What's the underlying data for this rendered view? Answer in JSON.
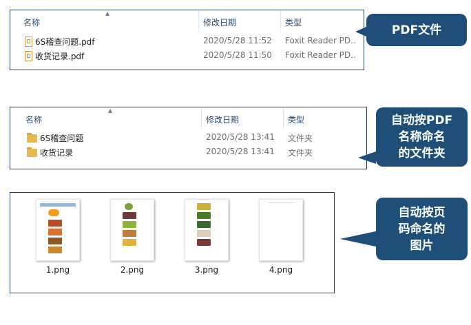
{
  "columns": {
    "name": "名称",
    "modified": "修改日期",
    "type": "类型"
  },
  "pdf_list": [
    {
      "name": "6S稽查问题.pdf",
      "date": "2020/5/28 11:52",
      "type": "Foxit Reader PD..."
    },
    {
      "name": "收货记录.pdf",
      "date": "2020/5/28 11:50",
      "type": "Foxit Reader PD..."
    }
  ],
  "folder_list": [
    {
      "name": "6S稽查问题",
      "date": "2020/5/28 13:41",
      "type": "文件夹"
    },
    {
      "name": "收货记录",
      "date": "2020/5/28 13:41",
      "type": "文件夹"
    }
  ],
  "images": [
    {
      "name": "1.png"
    },
    {
      "name": "2.png"
    },
    {
      "name": "3.png"
    },
    {
      "name": "4.png"
    }
  ],
  "callouts": {
    "pdf": "PDF文件",
    "folders_line1": "自动按PDF",
    "folders_line2": "名称命名",
    "folders_line3": "的文件夹",
    "images_line1": "自动按页",
    "images_line2": "码命名的",
    "images_line3": "图片"
  },
  "colors": {
    "callout_bg": "#1f4e79",
    "panel_border": "#1f3c5e"
  },
  "icons": {
    "pdf": "pdf-file-icon",
    "folder": "folder-icon",
    "sort": "sort-ascending-icon"
  }
}
